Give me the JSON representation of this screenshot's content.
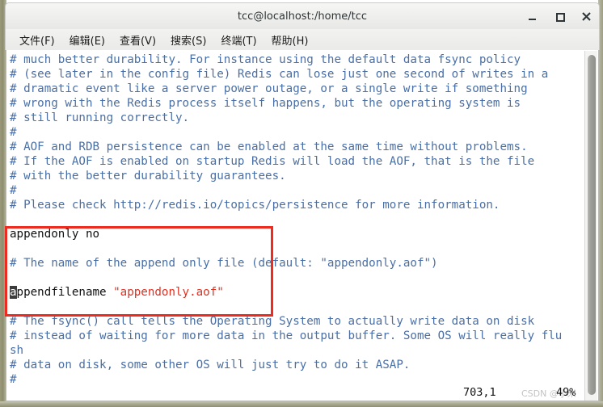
{
  "window": {
    "title": "tcc@localhost:/home/tcc",
    "controls": {
      "minimize": "minimize",
      "maximize": "maximize",
      "close": "close"
    }
  },
  "menubar": {
    "items": [
      {
        "label": "文件(F)"
      },
      {
        "label": "编辑(E)"
      },
      {
        "label": "查看(V)"
      },
      {
        "label": "搜索(S)"
      },
      {
        "label": "终端(T)"
      },
      {
        "label": "帮助(H)"
      }
    ]
  },
  "terminal": {
    "lines": [
      {
        "id": "l01",
        "text": "# much better durability. For instance using the default data fsync policy",
        "style": "comment"
      },
      {
        "id": "l02",
        "text": "# (see later in the config file) Redis can lose just one second of writes in a",
        "style": "comment"
      },
      {
        "id": "l03",
        "text": "# dramatic event like a server power outage, or a single write if something",
        "style": "comment"
      },
      {
        "id": "l04",
        "text": "# wrong with the Redis process itself happens, but the operating system is",
        "style": "comment"
      },
      {
        "id": "l05",
        "text": "# still running correctly.",
        "style": "comment"
      },
      {
        "id": "l06",
        "text": "#",
        "style": "comment"
      },
      {
        "id": "l07",
        "text": "# AOF and RDB persistence can be enabled at the same time without problems.",
        "style": "comment"
      },
      {
        "id": "l08",
        "text": "# If the AOF is enabled on startup Redis will load the AOF, that is the file",
        "style": "comment"
      },
      {
        "id": "l09",
        "text": "# with the better durability guarantees.",
        "style": "comment"
      },
      {
        "id": "l10",
        "text": "#",
        "style": "comment"
      },
      {
        "id": "l11",
        "text": "# Please check http://redis.io/topics/persistence for more information.",
        "style": "comment"
      },
      {
        "id": "l12",
        "text": "",
        "style": "blank"
      },
      {
        "id": "l13",
        "text": "appendonly no",
        "style": "plain"
      },
      {
        "id": "l14",
        "text": "",
        "style": "blank"
      },
      {
        "id": "l15",
        "text": "# The name of the append only file (default: \"appendonly.aof\")",
        "style": "comment"
      },
      {
        "id": "l16",
        "text": "",
        "style": "blank"
      },
      {
        "id": "l17",
        "style": "mixed",
        "cursor_char": "a",
        "segments": [
          {
            "text": "ppendfilename ",
            "style": "plain"
          },
          {
            "text": "\"appendonly.aof\"",
            "style": "string"
          }
        ]
      },
      {
        "id": "l18",
        "text": "",
        "style": "blank"
      },
      {
        "id": "l19",
        "text": "# The fsync() call tells the Operating System to actually write data on disk",
        "style": "comment"
      },
      {
        "id": "l20",
        "text": "# instead of waiting for more data in the output buffer. Some OS will really flu",
        "style": "comment"
      },
      {
        "id": "l21",
        "text": "sh",
        "style": "comment"
      },
      {
        "id": "l22",
        "text": "# data on disk, some other OS will just try to do it ASAP.",
        "style": "comment"
      },
      {
        "id": "l23",
        "text": "#",
        "style": "comment"
      }
    ],
    "colors": {
      "comment": "#4a6fa5",
      "plain": "#111111",
      "string": "#e03020",
      "cursor_bg": "#3c3c3c",
      "background": "#ffffff"
    }
  },
  "annotation": {
    "color": "#ef2a1e",
    "label": "highlight-box"
  },
  "status": {
    "position": "703,1",
    "percent": "49%",
    "watermark": "CSDN @小米"
  }
}
